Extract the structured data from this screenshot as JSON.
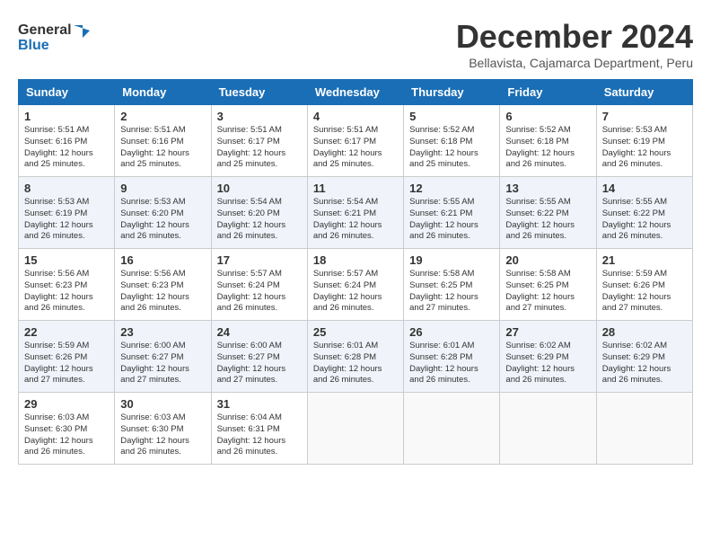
{
  "header": {
    "logo_line1": "General",
    "logo_line2": "Blue",
    "title": "December 2024",
    "location": "Bellavista, Cajamarca Department, Peru"
  },
  "columns": [
    "Sunday",
    "Monday",
    "Tuesday",
    "Wednesday",
    "Thursday",
    "Friday",
    "Saturday"
  ],
  "weeks": [
    [
      {
        "day": 1,
        "info": "Sunrise: 5:51 AM\nSunset: 6:16 PM\nDaylight: 12 hours\nand 25 minutes."
      },
      {
        "day": 2,
        "info": "Sunrise: 5:51 AM\nSunset: 6:16 PM\nDaylight: 12 hours\nand 25 minutes."
      },
      {
        "day": 3,
        "info": "Sunrise: 5:51 AM\nSunset: 6:17 PM\nDaylight: 12 hours\nand 25 minutes."
      },
      {
        "day": 4,
        "info": "Sunrise: 5:51 AM\nSunset: 6:17 PM\nDaylight: 12 hours\nand 25 minutes."
      },
      {
        "day": 5,
        "info": "Sunrise: 5:52 AM\nSunset: 6:18 PM\nDaylight: 12 hours\nand 25 minutes."
      },
      {
        "day": 6,
        "info": "Sunrise: 5:52 AM\nSunset: 6:18 PM\nDaylight: 12 hours\nand 26 minutes."
      },
      {
        "day": 7,
        "info": "Sunrise: 5:53 AM\nSunset: 6:19 PM\nDaylight: 12 hours\nand 26 minutes."
      }
    ],
    [
      {
        "day": 8,
        "info": "Sunrise: 5:53 AM\nSunset: 6:19 PM\nDaylight: 12 hours\nand 26 minutes."
      },
      {
        "day": 9,
        "info": "Sunrise: 5:53 AM\nSunset: 6:20 PM\nDaylight: 12 hours\nand 26 minutes."
      },
      {
        "day": 10,
        "info": "Sunrise: 5:54 AM\nSunset: 6:20 PM\nDaylight: 12 hours\nand 26 minutes."
      },
      {
        "day": 11,
        "info": "Sunrise: 5:54 AM\nSunset: 6:21 PM\nDaylight: 12 hours\nand 26 minutes."
      },
      {
        "day": 12,
        "info": "Sunrise: 5:55 AM\nSunset: 6:21 PM\nDaylight: 12 hours\nand 26 minutes."
      },
      {
        "day": 13,
        "info": "Sunrise: 5:55 AM\nSunset: 6:22 PM\nDaylight: 12 hours\nand 26 minutes."
      },
      {
        "day": 14,
        "info": "Sunrise: 5:55 AM\nSunset: 6:22 PM\nDaylight: 12 hours\nand 26 minutes."
      }
    ],
    [
      {
        "day": 15,
        "info": "Sunrise: 5:56 AM\nSunset: 6:23 PM\nDaylight: 12 hours\nand 26 minutes."
      },
      {
        "day": 16,
        "info": "Sunrise: 5:56 AM\nSunset: 6:23 PM\nDaylight: 12 hours\nand 26 minutes."
      },
      {
        "day": 17,
        "info": "Sunrise: 5:57 AM\nSunset: 6:24 PM\nDaylight: 12 hours\nand 26 minutes."
      },
      {
        "day": 18,
        "info": "Sunrise: 5:57 AM\nSunset: 6:24 PM\nDaylight: 12 hours\nand 26 minutes."
      },
      {
        "day": 19,
        "info": "Sunrise: 5:58 AM\nSunset: 6:25 PM\nDaylight: 12 hours\nand 27 minutes."
      },
      {
        "day": 20,
        "info": "Sunrise: 5:58 AM\nSunset: 6:25 PM\nDaylight: 12 hours\nand 27 minutes."
      },
      {
        "day": 21,
        "info": "Sunrise: 5:59 AM\nSunset: 6:26 PM\nDaylight: 12 hours\nand 27 minutes."
      }
    ],
    [
      {
        "day": 22,
        "info": "Sunrise: 5:59 AM\nSunset: 6:26 PM\nDaylight: 12 hours\nand 27 minutes."
      },
      {
        "day": 23,
        "info": "Sunrise: 6:00 AM\nSunset: 6:27 PM\nDaylight: 12 hours\nand 27 minutes."
      },
      {
        "day": 24,
        "info": "Sunrise: 6:00 AM\nSunset: 6:27 PM\nDaylight: 12 hours\nand 27 minutes."
      },
      {
        "day": 25,
        "info": "Sunrise: 6:01 AM\nSunset: 6:28 PM\nDaylight: 12 hours\nand 26 minutes."
      },
      {
        "day": 26,
        "info": "Sunrise: 6:01 AM\nSunset: 6:28 PM\nDaylight: 12 hours\nand 26 minutes."
      },
      {
        "day": 27,
        "info": "Sunrise: 6:02 AM\nSunset: 6:29 PM\nDaylight: 12 hours\nand 26 minutes."
      },
      {
        "day": 28,
        "info": "Sunrise: 6:02 AM\nSunset: 6:29 PM\nDaylight: 12 hours\nand 26 minutes."
      }
    ],
    [
      {
        "day": 29,
        "info": "Sunrise: 6:03 AM\nSunset: 6:30 PM\nDaylight: 12 hours\nand 26 minutes."
      },
      {
        "day": 30,
        "info": "Sunrise: 6:03 AM\nSunset: 6:30 PM\nDaylight: 12 hours\nand 26 minutes."
      },
      {
        "day": 31,
        "info": "Sunrise: 6:04 AM\nSunset: 6:31 PM\nDaylight: 12 hours\nand 26 minutes."
      },
      null,
      null,
      null,
      null
    ]
  ]
}
